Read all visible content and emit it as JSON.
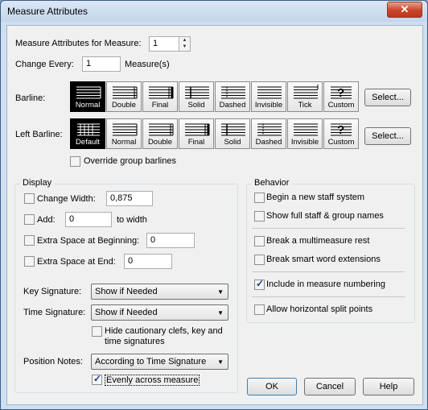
{
  "window": {
    "title": "Measure Attributes",
    "close_glyph": "✕"
  },
  "measure_attributes_for": {
    "label": "Measure Attributes for Measure:",
    "value": "1"
  },
  "change_every": {
    "label": "Change Every:",
    "value": "1",
    "unit": "Measure(s)"
  },
  "barline": {
    "label": "Barline:",
    "options": [
      "Normal",
      "Double",
      "Final",
      "Solid",
      "Dashed",
      "Invisible",
      "Tick",
      "Custom"
    ],
    "selected": "Normal",
    "select_button": "Select..."
  },
  "left_barline": {
    "label": "Left Barline:",
    "options": [
      "Default",
      "Normal",
      "Double",
      "Final",
      "Solid",
      "Dashed",
      "Invisible",
      "Custom"
    ],
    "selected": "Default",
    "select_button": "Select..."
  },
  "custom_glyph": "?",
  "override_group_barlines": {
    "label": "Override group barlines",
    "checked": false
  },
  "display": {
    "title": "Display",
    "change_width": {
      "label": "Change Width:",
      "value": "0,875",
      "checked": false
    },
    "add": {
      "label": "Add:",
      "value": "0",
      "suffix": "to width",
      "checked": false
    },
    "extra_space_beginning": {
      "label": "Extra Space at Beginning:",
      "value": "0",
      "checked": false
    },
    "extra_space_end": {
      "label": "Extra Space at End:",
      "value": "0",
      "checked": false
    },
    "key_signature": {
      "label": "Key Signature:",
      "value": "Show if Needed"
    },
    "time_signature": {
      "label": "Time Signature:",
      "value": "Show if Needed"
    },
    "hide_cautionary": {
      "label_line1": "Hide cautionary clefs, key and",
      "label_line2": "time signatures",
      "checked": false
    },
    "position_notes": {
      "label": "Position Notes:",
      "value": "According to Time Signature"
    },
    "evenly_across": {
      "label": "Evenly across measure",
      "checked": true
    }
  },
  "behavior": {
    "title": "Behavior",
    "begin_new_staff_system": {
      "label": "Begin a new staff system",
      "checked": false
    },
    "show_full_names": {
      "label": "Show full staff & group names",
      "checked": false
    },
    "break_multimeasure_rest": {
      "label": "Break a multimeasure rest",
      "checked": false
    },
    "break_word_extensions": {
      "label": "Break smart word extensions",
      "checked": false
    },
    "include_numbering": {
      "label": "Include in measure numbering",
      "checked": true
    },
    "allow_split_points": {
      "label": "Allow horizontal split points",
      "checked": false
    }
  },
  "buttons": {
    "ok": "OK",
    "cancel": "Cancel",
    "help": "Help"
  },
  "dropdown_arrow": "▼",
  "spin_up": "▲",
  "spin_down": "▼"
}
